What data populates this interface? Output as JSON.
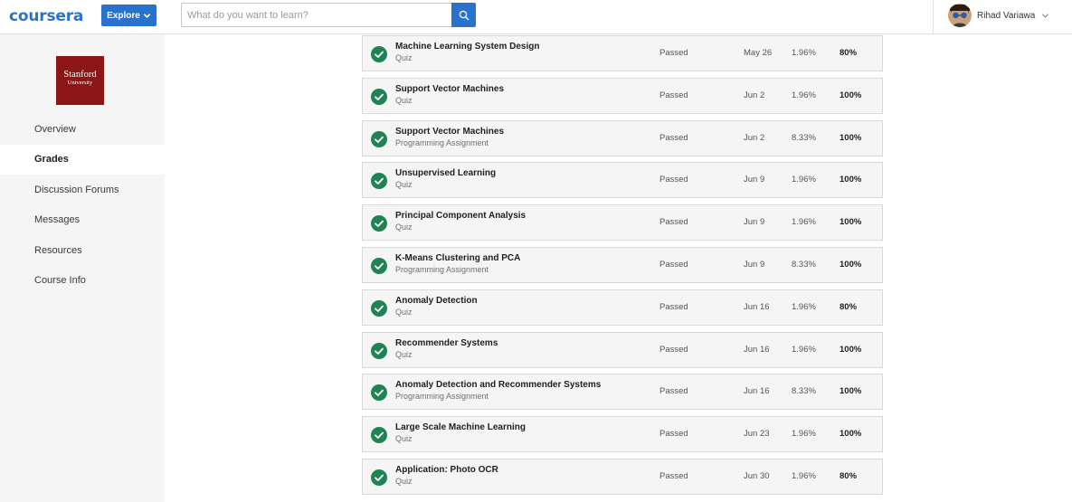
{
  "header": {
    "logo": "coursera",
    "explore_label": "Explore",
    "search_placeholder": "What do you want to learn?",
    "user_name": "Rihad Variawa"
  },
  "sidebar": {
    "university_line1": "Stanford",
    "university_line2": "University",
    "items": [
      {
        "label": "Overview",
        "active": false
      },
      {
        "label": "Grades",
        "active": true
      },
      {
        "label": "Discussion Forums",
        "active": false
      },
      {
        "label": "Messages",
        "active": false
      },
      {
        "label": "Resources",
        "active": false
      },
      {
        "label": "Course Info",
        "active": false
      }
    ]
  },
  "colors": {
    "brand": "#2a73cc",
    "passed_green": "#1f8354",
    "stanford_red": "#8c1515"
  },
  "grades": [
    {
      "title": "Machine Learning System Design",
      "type": "Quiz",
      "status": "Passed",
      "date": "May 26",
      "weight": "1.96%",
      "grade": "80%"
    },
    {
      "title": "Support Vector Machines",
      "type": "Quiz",
      "status": "Passed",
      "date": "Jun 2",
      "weight": "1.96%",
      "grade": "100%"
    },
    {
      "title": "Support Vector Machines",
      "type": "Programming Assignment",
      "status": "Passed",
      "date": "Jun 2",
      "weight": "8.33%",
      "grade": "100%"
    },
    {
      "title": "Unsupervised Learning",
      "type": "Quiz",
      "status": "Passed",
      "date": "Jun 9",
      "weight": "1.96%",
      "grade": "100%"
    },
    {
      "title": "Principal Component Analysis",
      "type": "Quiz",
      "status": "Passed",
      "date": "Jun 9",
      "weight": "1.96%",
      "grade": "100%"
    },
    {
      "title": "K-Means Clustering and PCA",
      "type": "Programming Assignment",
      "status": "Passed",
      "date": "Jun 9",
      "weight": "8.33%",
      "grade": "100%"
    },
    {
      "title": "Anomaly Detection",
      "type": "Quiz",
      "status": "Passed",
      "date": "Jun 16",
      "weight": "1.96%",
      "grade": "80%"
    },
    {
      "title": "Recommender Systems",
      "type": "Quiz",
      "status": "Passed",
      "date": "Jun 16",
      "weight": "1.96%",
      "grade": "100%"
    },
    {
      "title": "Anomaly Detection and Recommender Systems",
      "type": "Programming Assignment",
      "status": "Passed",
      "date": "Jun 16",
      "weight": "8.33%",
      "grade": "100%"
    },
    {
      "title": "Large Scale Machine Learning",
      "type": "Quiz",
      "status": "Passed",
      "date": "Jun 23",
      "weight": "1.96%",
      "grade": "100%"
    },
    {
      "title": "Application: Photo OCR",
      "type": "Quiz",
      "status": "Passed",
      "date": "Jun 30",
      "weight": "1.96%",
      "grade": "80%"
    }
  ]
}
